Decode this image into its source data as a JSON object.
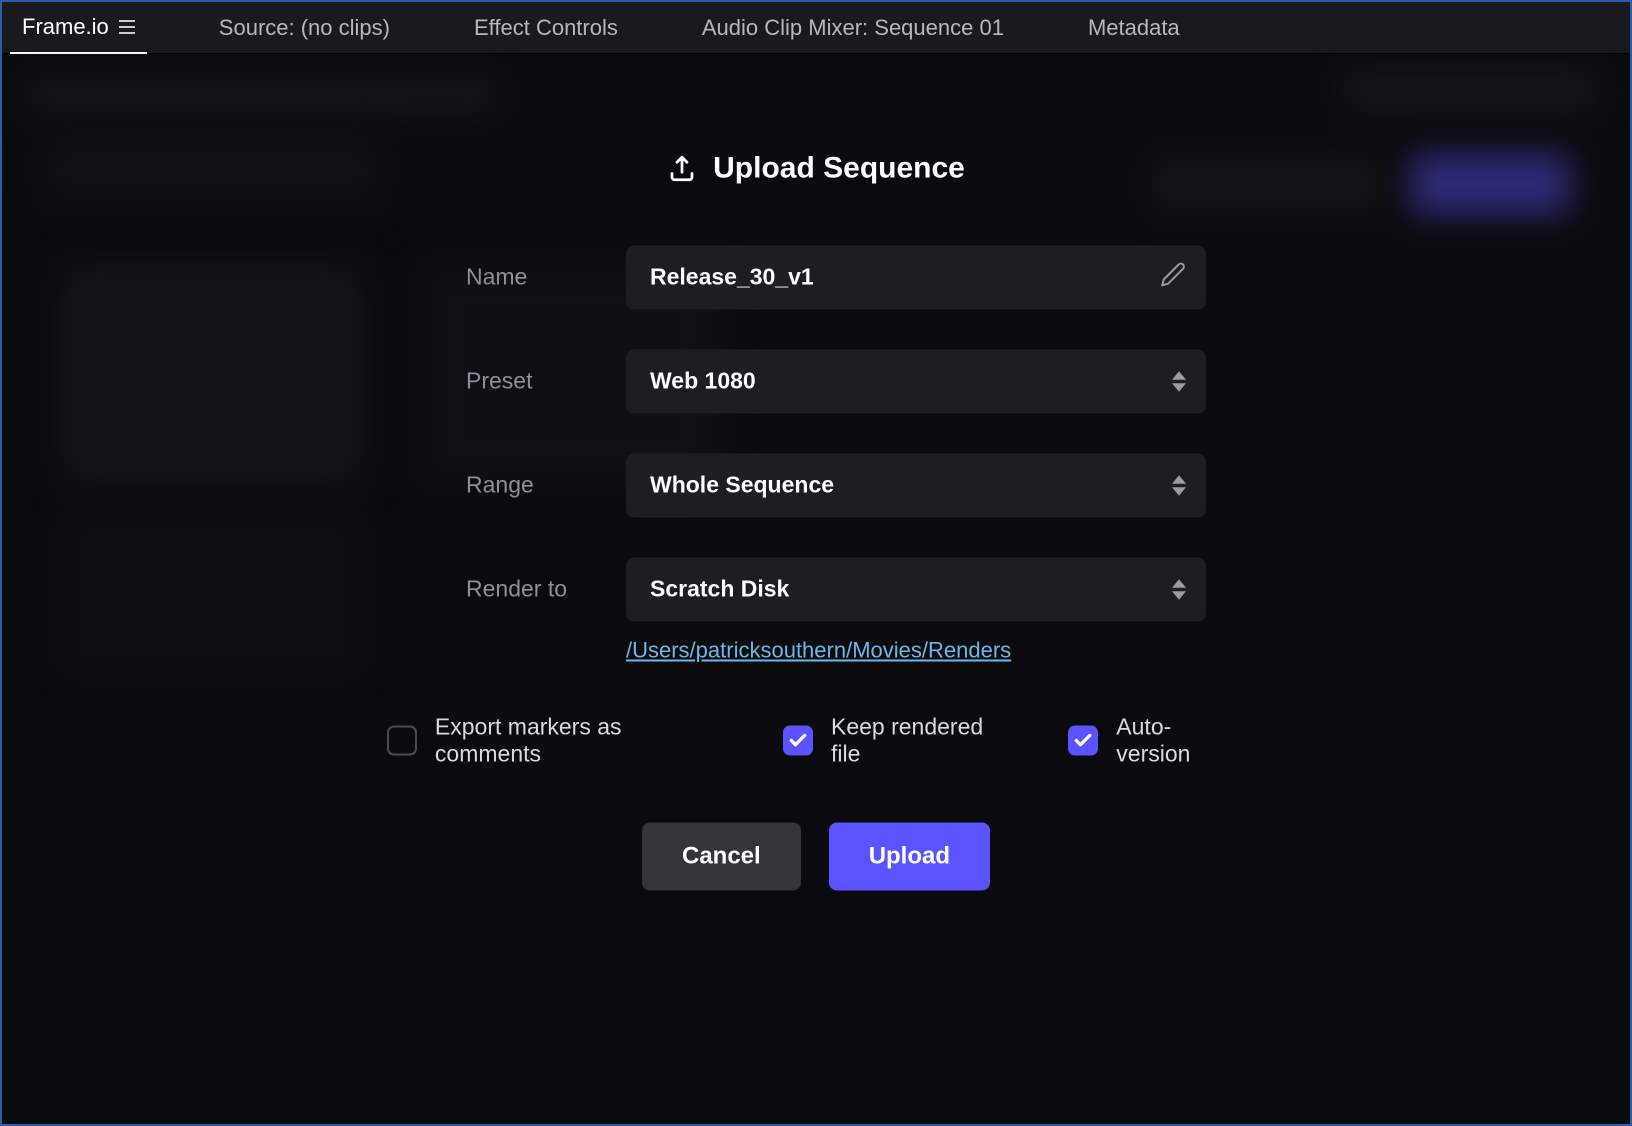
{
  "tabs": {
    "frameio": "Frame.io",
    "source": "Source: (no clips)",
    "effect_controls": "Effect Controls",
    "audio_mixer": "Audio Clip Mixer: Sequence 01",
    "metadata": "Metadata"
  },
  "modal": {
    "title": "Upload Sequence",
    "labels": {
      "name": "Name",
      "preset": "Preset",
      "range": "Range",
      "render_to": "Render to"
    },
    "values": {
      "name": "Release_30_v1",
      "preset": "Web 1080",
      "range": "Whole Sequence",
      "render_to": "Scratch Disk"
    },
    "render_path": "/Users/patricksouthern/Movies/Renders",
    "checkboxes": {
      "export_markers": "Export markers as comments",
      "keep_rendered": "Keep rendered file",
      "auto_version": "Auto-version"
    },
    "buttons": {
      "cancel": "Cancel",
      "upload": "Upload"
    }
  }
}
